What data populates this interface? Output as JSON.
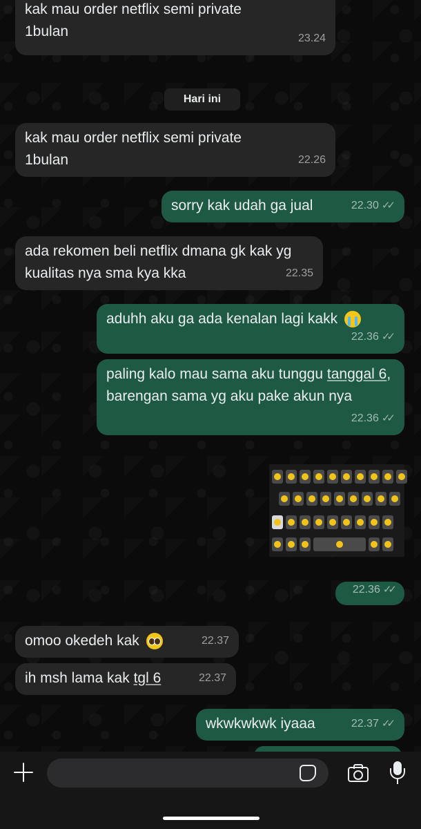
{
  "chat": {
    "date_chip": "Hari ini",
    "messages": [
      {
        "dir": "in",
        "text": "kak mau order netflix semi private 1bulan",
        "time": "23.24"
      },
      {
        "dir": "in",
        "text": "kak mau order netflix semi private 1bulan",
        "time": "22.26"
      },
      {
        "dir": "out",
        "text": "sorry kak udah ga jual",
        "time": "22.30"
      },
      {
        "dir": "in",
        "text": "ada rekomen beli netflix dmana gk kak yg kualitas nya sma kya kka",
        "time": "22.35"
      },
      {
        "dir": "out",
        "text": "aduhh aku ga ada kenalan lagi kakk",
        "emoji": "loudly-crying-face-emoji",
        "time": "22.36"
      },
      {
        "dir": "out",
        "text_a": "paling kalo mau sama aku tunggu",
        "text_b": "tanggal 6",
        "text_c": ", barengan sama yg aku pake akun nya",
        "time": "22.36"
      },
      {
        "dir": "out",
        "type": "image",
        "image": "crying-emoji-keyboard-sticker",
        "time": "22.36"
      },
      {
        "dir": "in",
        "text": "omoo okedeh kak",
        "emoji": "pleading-face-emoji",
        "time": "22.37"
      },
      {
        "dir": "in",
        "text_a": "ih msh lama kak ",
        "text_b": "tgl 6",
        "time": "22.37"
      },
      {
        "dir": "out",
        "text": "wkwkwkwk iyaaa",
        "time": "22.37"
      }
    ],
    "read_receipt": "double-check-icon"
  },
  "composer": {
    "placeholder": "",
    "icons": [
      "plus-icon",
      "sticker-icon",
      "camera-icon",
      "microphone-icon"
    ]
  },
  "colors": {
    "incoming_bubble": "#262626",
    "outgoing_bubble": "#1e5a43",
    "background": "#0b0b0b"
  }
}
